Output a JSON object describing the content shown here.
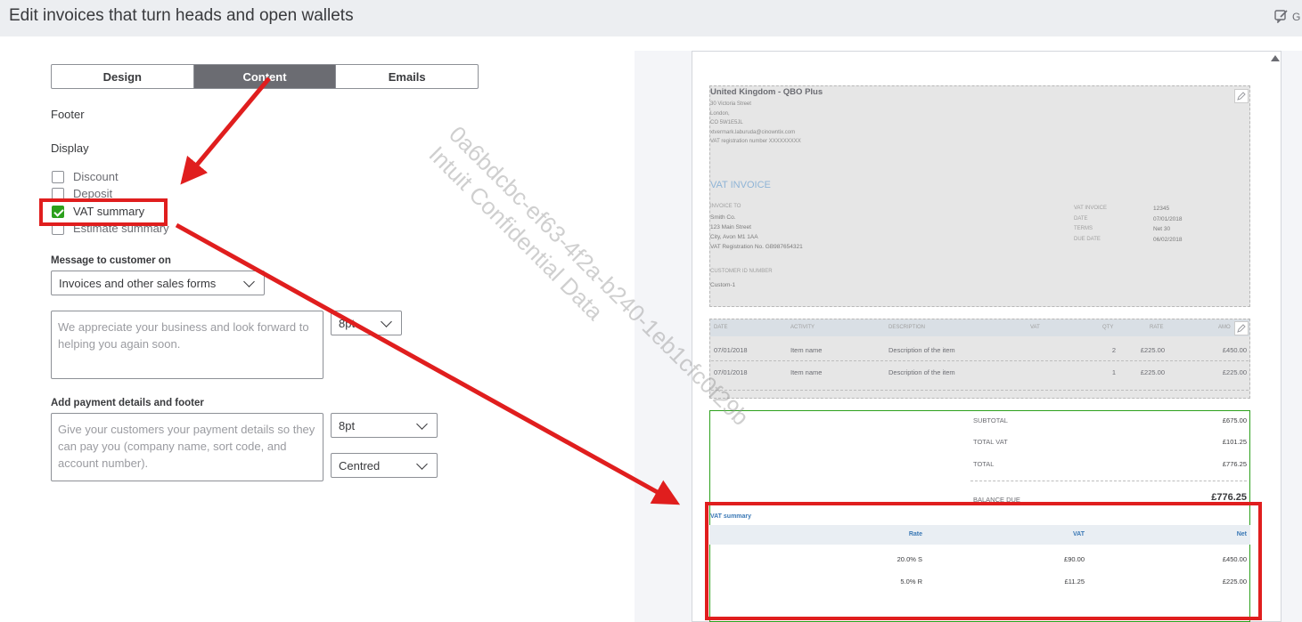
{
  "header": {
    "title": "Edit invoices that turn heads and open wallets",
    "feedback_label": "G"
  },
  "tabs": [
    {
      "label": "Design",
      "active": false
    },
    {
      "label": "Content",
      "active": true
    },
    {
      "label": "Emails",
      "active": false
    }
  ],
  "section": {
    "footer_label": "Footer",
    "display_label": "Display"
  },
  "checkboxes": [
    {
      "label": "Discount",
      "checked": false
    },
    {
      "label": "Deposit",
      "checked": false
    },
    {
      "label": "VAT summary",
      "checked": true
    },
    {
      "label": "Estimate summary",
      "checked": false
    }
  ],
  "message": {
    "label": "Message to customer on",
    "select_value": "Invoices and other sales forms",
    "placeholder": "We appreciate your business and look forward to helping you again soon.",
    "font_size": "8pt"
  },
  "payment": {
    "label": "Add payment details and footer",
    "placeholder": "Give your customers your payment details so they can pay you (company name, sort code, and account number).",
    "font_size": "8pt",
    "alignment": "Centred"
  },
  "watermark": {
    "line1": "0a6bdcbc-ef63-4f2a-b240-1eb1cfc0f29b",
    "line2": "Intuit Confidential Data"
  },
  "invoice": {
    "company": "United Kingdom - QBO Plus",
    "address_lines": [
      "30 Victoria Street",
      "London,",
      "CO 5W1E5JL",
      "xtvermark.laburuda@cinowntix.com",
      "VAT registration number XXXXXXXXX"
    ],
    "doc_title": "VAT INVOICE",
    "invoice_to_label": "INVOICE TO",
    "invoice_to_lines": [
      "Smith Co.",
      "123 Main Street",
      "City, Avon M1 1AA",
      "VAT Registration No. GB987654321"
    ],
    "meta": [
      {
        "label": "VAT INVOICE",
        "value": "12345"
      },
      {
        "label": "DATE",
        "value": "07/01/2018"
      },
      {
        "label": "TERMS",
        "value": "Net 30"
      },
      {
        "label": "DUE DATE",
        "value": "06/02/2018"
      }
    ],
    "customer_id_label": "CUSTOMER ID NUMBER",
    "customer_id_value": "Custom-1",
    "columns": [
      "DATE",
      "ACTIVITY",
      "DESCRIPTION",
      "VAT",
      "QTY",
      "RATE",
      "AMO"
    ],
    "rows": [
      {
        "date": "07/01/2018",
        "activity": "Item name",
        "description": "Description of the item",
        "qty": "2",
        "rate": "£225.00",
        "amount": "£450.00"
      },
      {
        "date": "07/01/2018",
        "activity": "Item name",
        "description": "Description of the item",
        "qty": "1",
        "rate": "£225.00",
        "amount": "£225.00"
      }
    ],
    "totals": [
      {
        "label": "SUBTOTAL",
        "value": "£675.00"
      },
      {
        "label": "TOTAL VAT",
        "value": "£101.25"
      },
      {
        "label": "TOTAL",
        "value": "£776.25"
      }
    ],
    "balance_due_label": "BALANCE DUE",
    "balance_due_value": "£776.25",
    "vat_summary_title": "VAT summary",
    "vat_columns": [
      "Rate",
      "VAT",
      "Net"
    ],
    "vat_rows": [
      {
        "rate": "20.0% S",
        "vat": "£90.00",
        "net": "£450.00"
      },
      {
        "rate": "5.0% R",
        "vat": "£11.25",
        "net": "£225.00"
      }
    ]
  },
  "colors": {
    "accent_green": "#2ca01c",
    "annotation_red": "#e01e1e",
    "active_tab": "#6b6c72"
  }
}
